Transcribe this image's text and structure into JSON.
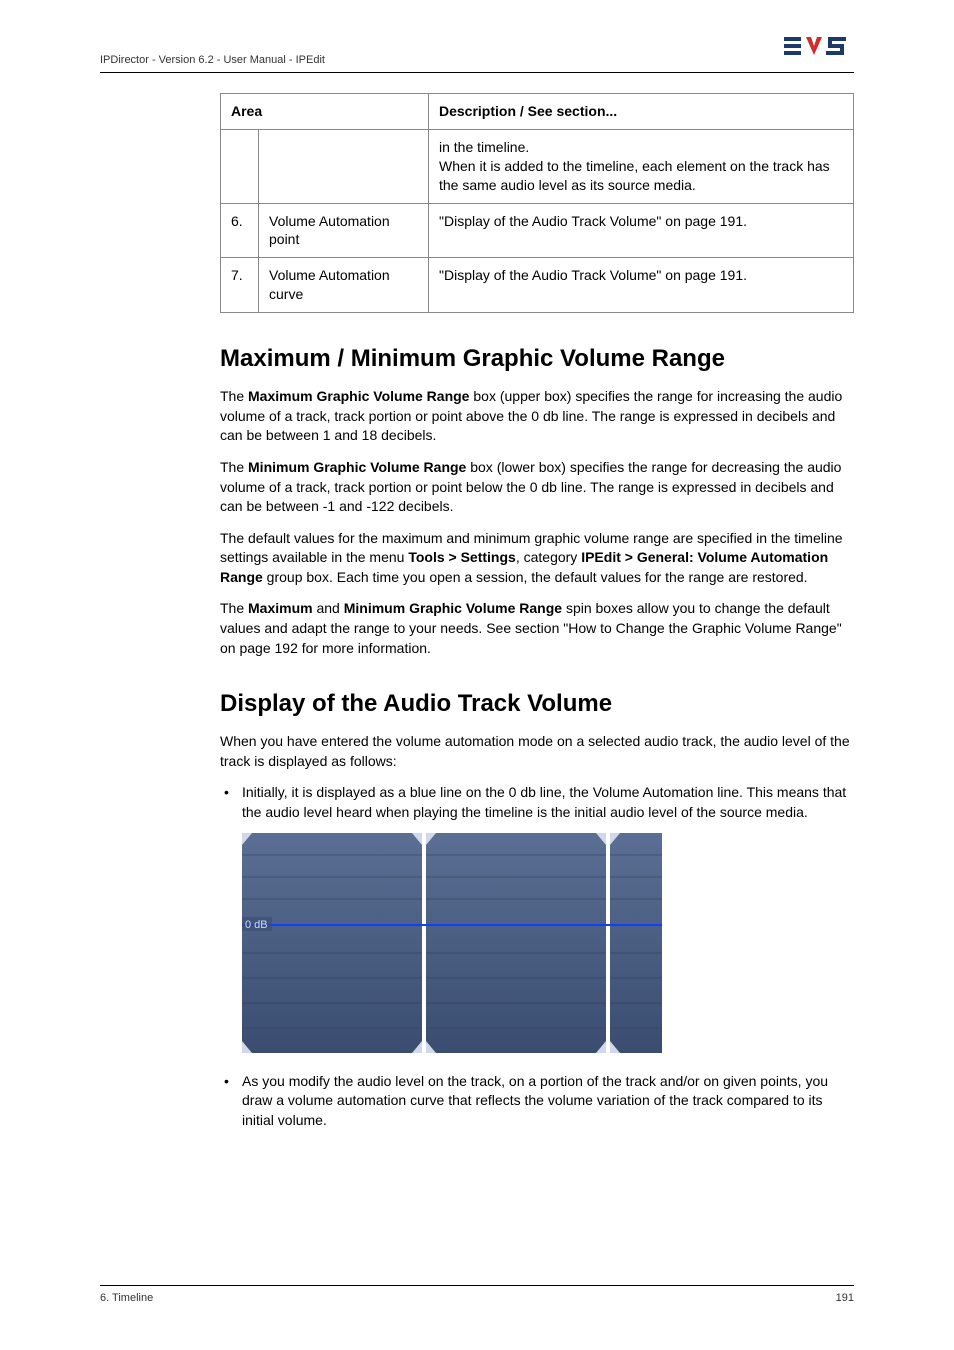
{
  "header": {
    "text": "IPDirector - Version 6.2 - User Manual - IPEdit"
  },
  "table": {
    "head_area": "Area",
    "head_desc": "Description / See section...",
    "rows": [
      {
        "num": "",
        "label": "",
        "desc_line1": "in the timeline.",
        "desc_line2": "When it is added to the timeline, each element on the track has the same audio level as its source media."
      },
      {
        "num": "6.",
        "label": "Volume Automation point",
        "desc": "\"Display of the Audio Track Volume\" on page 191."
      },
      {
        "num": "7.",
        "label": "Volume Automation curve",
        "desc": "\"Display of the Audio Track Volume\" on page 191."
      }
    ]
  },
  "section1": {
    "title": "Maximum / Minimum Graphic Volume Range",
    "p1_pre": "The ",
    "p1_b1": "Maximum Graphic Volume Range",
    "p1_post": " box (upper box) specifies the range for increasing the audio volume of a track, track portion or point above the 0 db line. The range is expressed in decibels and can be between 1 and 18 decibels.",
    "p2_pre": "The ",
    "p2_b1": "Minimum Graphic Volume Range",
    "p2_post": " box (lower box) specifies the range for decreasing the audio volume of a track, track portion or point below the 0 db line. The range is expressed in decibels and can be between -1 and -122 decibels.",
    "p3_pre": "The default values for the maximum and minimum graphic volume range are specified in the timeline settings available in the menu ",
    "p3_b1": "Tools > Settings",
    "p3_mid1": ", category ",
    "p3_b2": "IPEdit > General: Volume Automation Range",
    "p3_post": " group box. Each time you open a session, the default values for the range are restored.",
    "p4_pre": "The ",
    "p4_b1": "Maximum",
    "p4_mid": " and ",
    "p4_b2": "Minimum Graphic Volume Range",
    "p4_post": " spin boxes allow you to change the default values and adapt the range to your needs. See section \"How to Change the Graphic Volume Range\" on page 192 for more information."
  },
  "section2": {
    "title": "Display of the Audio Track Volume",
    "p1": "When you have entered the volume automation mode on a selected audio track, the audio level of the track is displayed as follows:",
    "li1": "Initially, it is displayed as a blue line on the 0 db line, the Volume Automation line. This means that the audio level heard when playing the timeline is the initial audio level of the source media.",
    "li2": "As you modify the audio level on the track, on a portion of the track and/or on given points, you draw a volume automation curve that reflects the volume variation of the track compared to its initial volume."
  },
  "screenshot": {
    "label": "0 dB"
  },
  "footer": {
    "left": "6. Timeline",
    "right": "191"
  }
}
